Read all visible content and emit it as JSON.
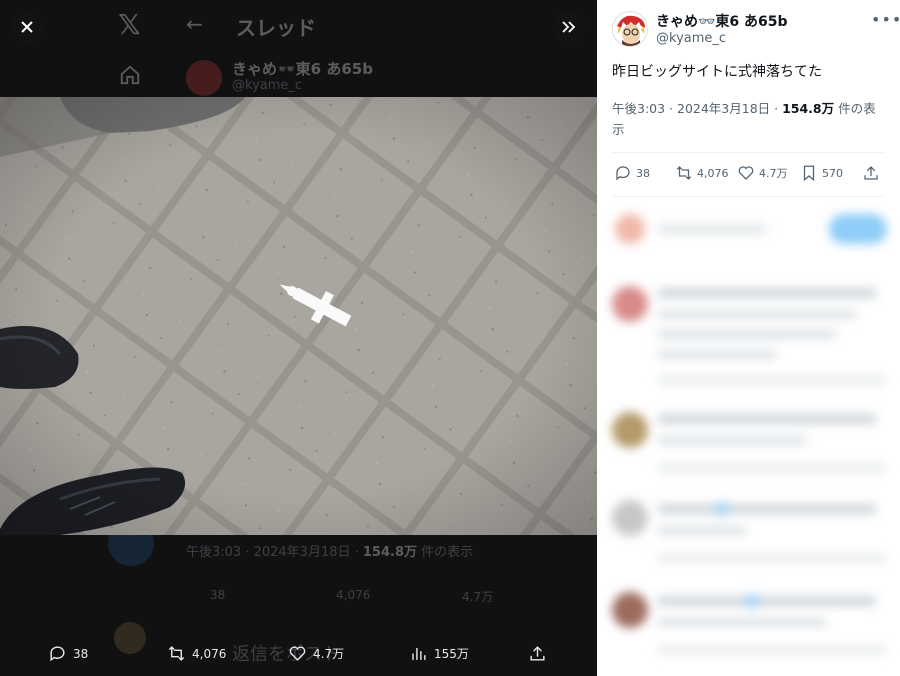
{
  "viewer": {
    "background_thread_title": "スレッド",
    "background_user_name": "きゃめ👓東6 あ65b",
    "background_handle": "@kyame_c",
    "background_time": "午後3:03 · 2024年3月18日 · ",
    "background_views": "154.8万",
    "background_views_suffix": " 件の表示",
    "background_reply_placeholder": "返信をポスト",
    "background_actions": [
      "38",
      "4,076",
      "4.7万"
    ],
    "actions": {
      "replies": "38",
      "reposts": "4,076",
      "likes": "4.7万",
      "views": "155万"
    },
    "icons": [
      "close-icon",
      "expand-icon",
      "reply-icon",
      "repost-icon",
      "like-icon",
      "views-icon",
      "share-icon"
    ]
  },
  "post": {
    "user_name": "きゃめ👓東6 あ65b",
    "handle": "@kyame_c",
    "text": "昨日ビッグサイトに式神落ちてた",
    "time": "午後3:03 · 2024年3月18日 · ",
    "views": "154.8万",
    "views_suffix": " 件の表示",
    "actions": {
      "replies": "38",
      "reposts": "4,076",
      "likes": "4.7万",
      "bookmarks": "570"
    }
  },
  "colors": {
    "text": "#0f1419",
    "secondary": "#536471",
    "separator": "#eff3f4",
    "follow_button": "#1d9bf0"
  }
}
